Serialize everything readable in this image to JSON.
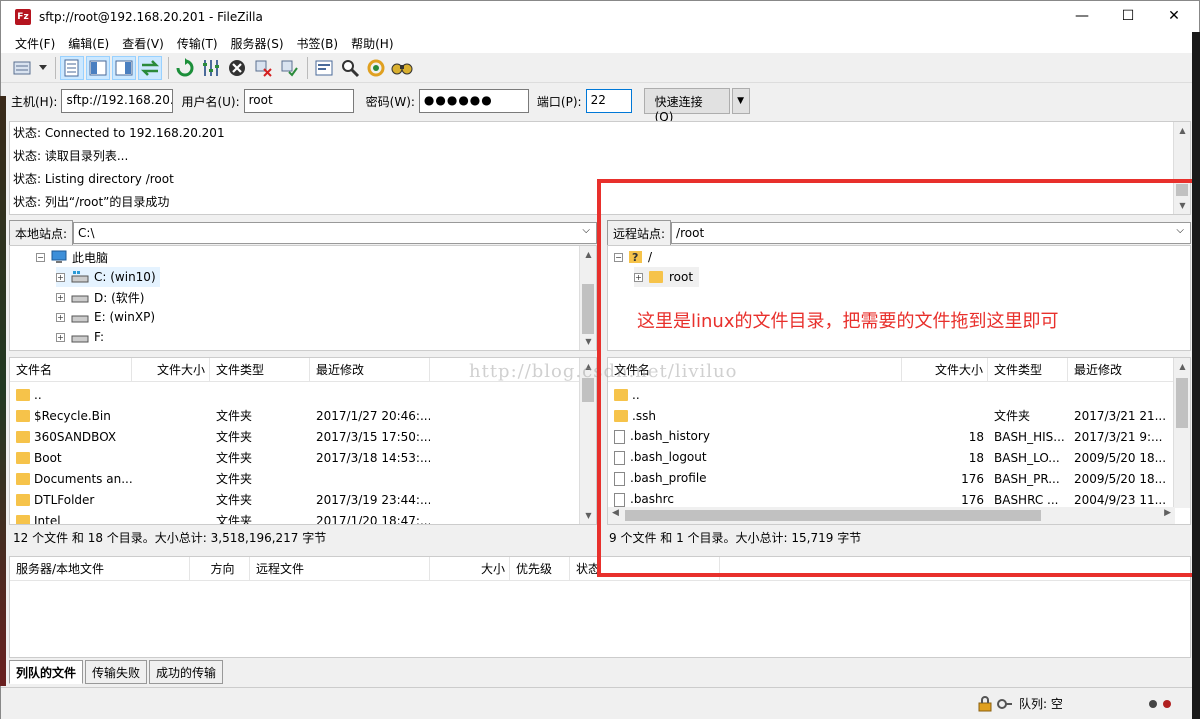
{
  "window": {
    "title": "sftp://root@192.168.20.201 - FileZilla",
    "app_icon": "Fz",
    "controls": {
      "minimize": "—",
      "maximize": "☐",
      "close": "✕"
    }
  },
  "menu": [
    "文件(F)",
    "编辑(E)",
    "查看(V)",
    "传输(T)",
    "服务器(S)",
    "书签(B)",
    "帮助(H)"
  ],
  "quickconnect": {
    "host_label": "主机(H):",
    "host_value": "sftp://192.168.20.",
    "user_label": "用户名(U):",
    "user_value": "root",
    "pass_label": "密码(W):",
    "pass_value": "●●●●●●",
    "port_label": "端口(P):",
    "port_value": "22",
    "connect_label": "快速连接(Q)",
    "dropdown": "▼"
  },
  "log": [
    "状态:  Connected to 192.168.20.201",
    "状态:  读取目录列表...",
    "状态:  Listing directory /root",
    "状态:  列出“/root”的目录成功"
  ],
  "local": {
    "site_label": "本地站点:",
    "path": "C:\\",
    "tree": [
      {
        "label": "此电脑",
        "type": "computer",
        "indent": 0,
        "toggle": "−"
      },
      {
        "label": "C: (win10)",
        "type": "drive",
        "indent": 1,
        "toggle": "+"
      },
      {
        "label": "D: (软件)",
        "type": "drive",
        "indent": 1,
        "toggle": "+"
      },
      {
        "label": "E: (winXP)",
        "type": "drive",
        "indent": 1,
        "toggle": "+"
      },
      {
        "label": "F:",
        "type": "drive",
        "indent": 1,
        "toggle": "+"
      }
    ],
    "columns": [
      "文件名",
      "文件大小",
      "文件类型",
      "最近修改"
    ],
    "files": [
      {
        "name": "..",
        "size": "",
        "type": "",
        "modified": ""
      },
      {
        "name": "$Recycle.Bin",
        "size": "",
        "type": "文件夹",
        "modified": "2017/1/27 20:46:..."
      },
      {
        "name": "360SANDBOX",
        "size": "",
        "type": "文件夹",
        "modified": "2017/3/15 17:50:..."
      },
      {
        "name": "Boot",
        "size": "",
        "type": "文件夹",
        "modified": "2017/3/18 14:53:..."
      },
      {
        "name": "Documents an...",
        "size": "",
        "type": "文件夹",
        "modified": ""
      },
      {
        "name": "DTLFolder",
        "size": "",
        "type": "文件夹",
        "modified": "2017/3/19 23:44:..."
      },
      {
        "name": "Intel",
        "size": "",
        "type": "文件夹",
        "modified": "2017/1/20 18:47:..."
      }
    ],
    "summary": "12 个文件 和 18 个目录。大小总计: 3,518,196,217 字节"
  },
  "remote": {
    "site_label": "远程站点:",
    "path": "/root",
    "tree": [
      {
        "label": "/",
        "type": "unknown",
        "indent": 0,
        "toggle": "−"
      },
      {
        "label": "root",
        "type": "folder",
        "indent": 1,
        "toggle": "+"
      }
    ],
    "columns": [
      "文件名",
      "文件大小",
      "文件类型",
      "最近修改"
    ],
    "files": [
      {
        "name": "..",
        "size": "",
        "type": "",
        "modified": "",
        "kind": "folder"
      },
      {
        "name": ".ssh",
        "size": "",
        "type": "文件夹",
        "modified": "2017/3/21 21...",
        "kind": "folder"
      },
      {
        "name": ".bash_history",
        "size": "18",
        "type": "BASH_HIS...",
        "modified": "2017/3/21 9:...",
        "kind": "file"
      },
      {
        "name": ".bash_logout",
        "size": "18",
        "type": "BASH_LO...",
        "modified": "2009/5/20 18...",
        "kind": "file"
      },
      {
        "name": ".bash_profile",
        "size": "176",
        "type": "BASH_PR...",
        "modified": "2009/5/20 18...",
        "kind": "file"
      },
      {
        "name": ".bashrc",
        "size": "176",
        "type": "BASHRC ...",
        "modified": "2004/9/23 11...",
        "kind": "file"
      }
    ],
    "summary": "9 个文件 和 1 个目录。大小总计: 15,719 字节"
  },
  "annotation": "这里是linux的文件目录，把需要的文件拖到这里即可",
  "watermark": "http://blog.csdn.net/liviluo",
  "queue": {
    "columns": [
      "服务器/本地文件",
      "方向",
      "远程文件",
      "大小",
      "优先级",
      "状态"
    ],
    "tabs": [
      "列队的文件",
      "传输失败",
      "成功的传输"
    ]
  },
  "statusbar": {
    "queue_label": "队列: 空"
  },
  "colors": {
    "highlight": "#e8302c",
    "folder": "#f6c34a",
    "selection": "#cce8ff"
  }
}
